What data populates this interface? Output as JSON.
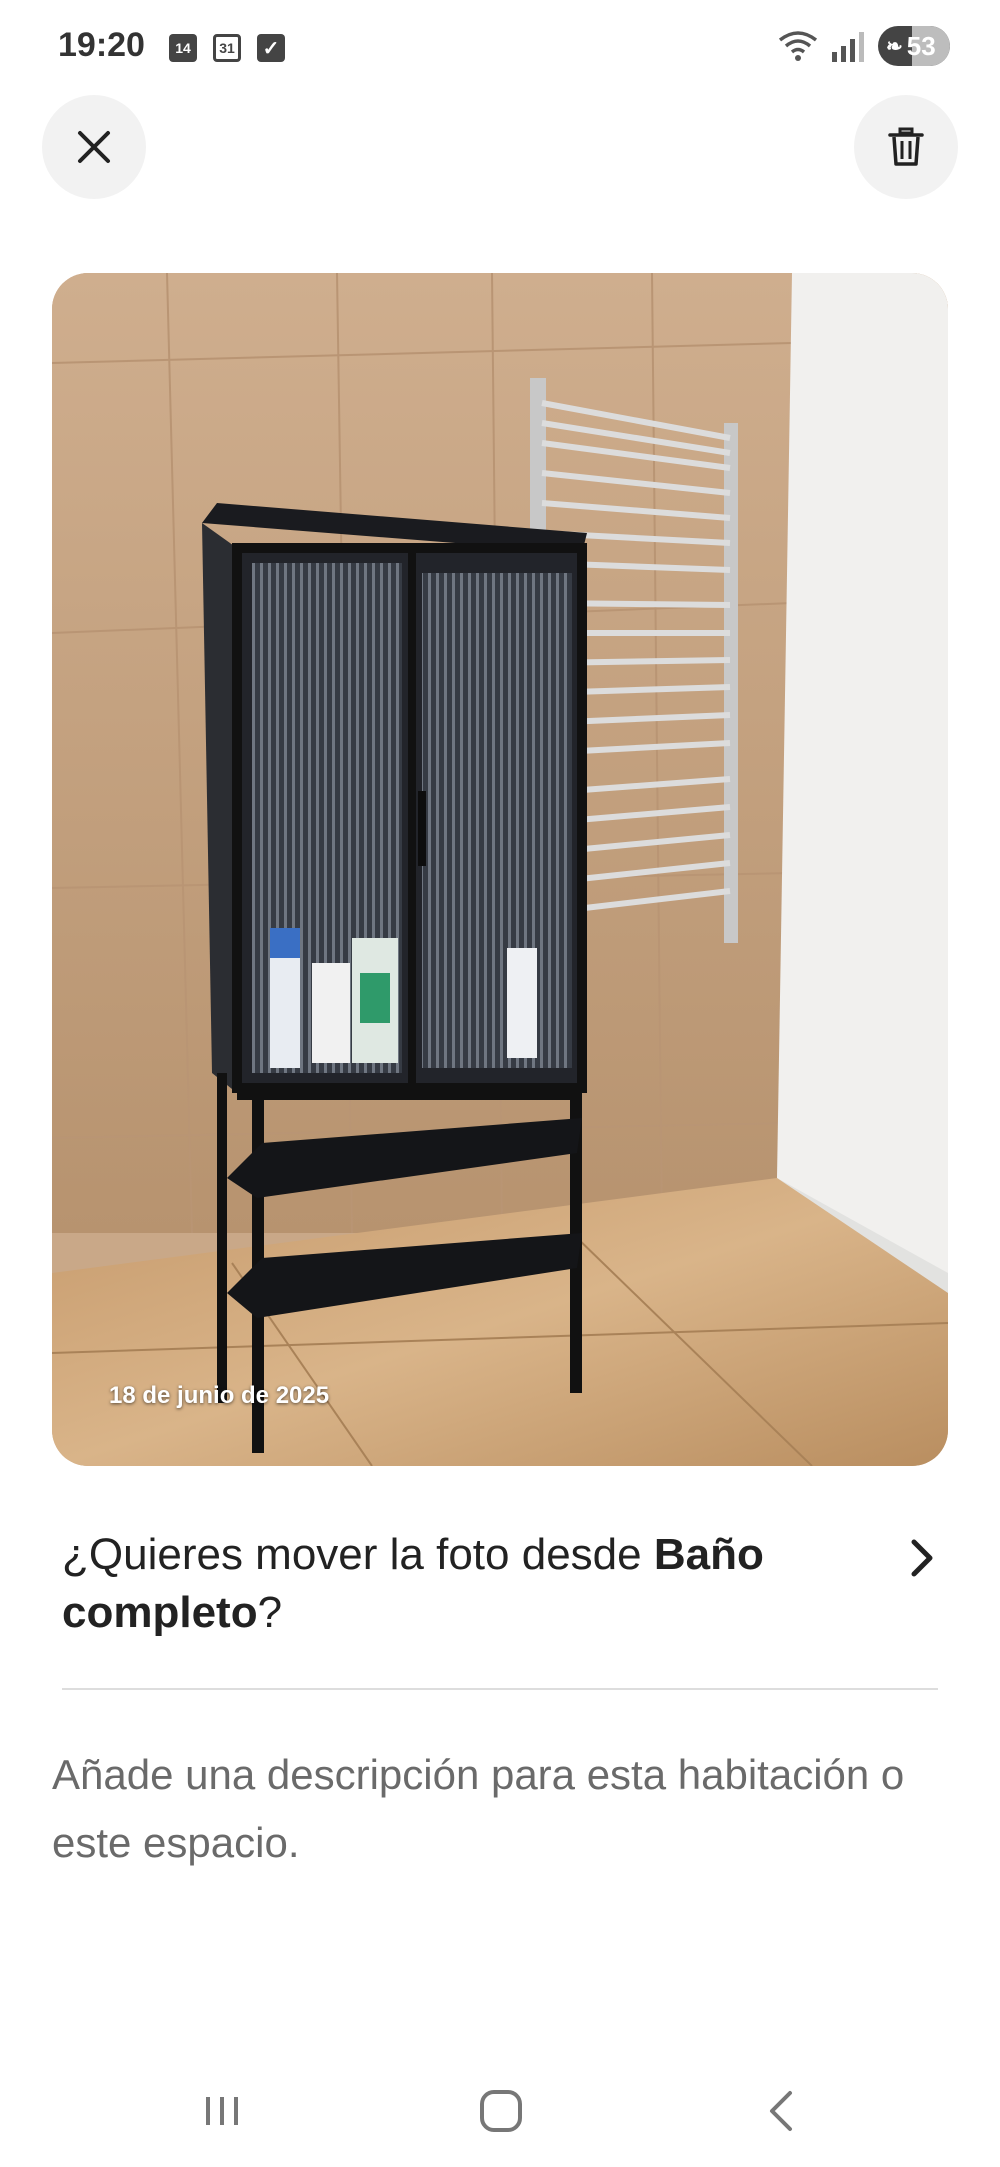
{
  "status_bar": {
    "time": "19:20",
    "cal_day_icon_text": "14",
    "cal_month_icon_text": "31",
    "battery_level": "53",
    "icons": [
      "calendar-14-icon",
      "calendar-31-icon",
      "checkbox-icon",
      "wifi-icon",
      "signal-icon",
      "battery-icon"
    ]
  },
  "header": {
    "close_icon": "close-icon",
    "delete_icon": "trash-icon"
  },
  "photo": {
    "date_overlay": "18 de junio de 2025"
  },
  "move_prompt": {
    "text_before": "¿Quieres mover la foto desde ",
    "room_name": "Baño completo",
    "text_after": "?",
    "chevron_icon": "chevron-right-icon"
  },
  "description": {
    "placeholder": "Añade una descripción para esta habitación o este espacio."
  },
  "nav_bar": {
    "icons": [
      "recents-icon",
      "home-icon",
      "back-icon"
    ]
  },
  "colors": {
    "text_primary": "#222222",
    "text_secondary": "#6a6a6a",
    "button_bg": "#f2f2f2",
    "divider": "#dddddd"
  }
}
